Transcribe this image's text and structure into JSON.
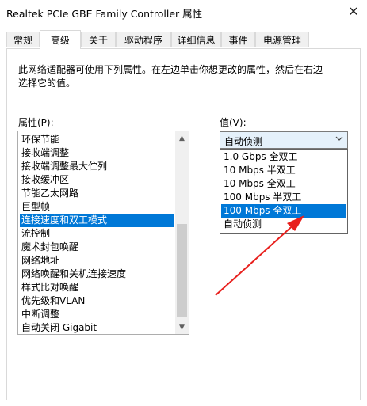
{
  "window": {
    "title": "Realtek PCIe GBE Family Controller 属性",
    "close_glyph": "✕"
  },
  "tabs": [
    {
      "label": "常规"
    },
    {
      "label": "高级"
    },
    {
      "label": "关于"
    },
    {
      "label": "驱动程序"
    },
    {
      "label": "详细信息"
    },
    {
      "label": "事件"
    },
    {
      "label": "电源管理"
    }
  ],
  "active_tab": "高级",
  "description": "此网络适配器可使用下列属性。在左边单击你想更改的属性，然后在右边选择它的值。",
  "property": {
    "label": "属性(P):",
    "items": [
      {
        "label": "环保节能"
      },
      {
        "label": "接收端调整"
      },
      {
        "label": "接收端调整最大伫列"
      },
      {
        "label": "接收缓冲区"
      },
      {
        "label": "节能乙太网路"
      },
      {
        "label": "巨型帧"
      },
      {
        "label": "连接速度和双工模式"
      },
      {
        "label": "流控制"
      },
      {
        "label": "魔术封包唤醒"
      },
      {
        "label": "网络地址"
      },
      {
        "label": "网络唤醒和关机连接速度"
      },
      {
        "label": "样式比对唤醒"
      },
      {
        "label": "优先级和VLAN"
      },
      {
        "label": "中断调整"
      },
      {
        "label": "自动关闭 Gigabit"
      }
    ],
    "selected": "连接速度和双工模式"
  },
  "value": {
    "label": "值(V):",
    "current": "自动侦测",
    "options": [
      {
        "label": "1.0 Gbps 全双工"
      },
      {
        "label": "10 Mbps 半双工"
      },
      {
        "label": "10 Mbps 全双工"
      },
      {
        "label": "100 Mbps 半双工"
      },
      {
        "label": "100 Mbps 全双工"
      },
      {
        "label": "自动侦测"
      }
    ],
    "highlighted": "100 Mbps 全双工"
  },
  "icons": {
    "close": "close-icon",
    "combo_arrow": "chevron-down-icon",
    "scroll_up": "scroll-up-arrow-icon",
    "scroll_down": "scroll-down-arrow-icon",
    "annotation": "red-arrow-annotation"
  },
  "colors": {
    "selection": "#0078d7",
    "combo_bg": "#e5f1fb",
    "annotation": "#e8201d"
  }
}
